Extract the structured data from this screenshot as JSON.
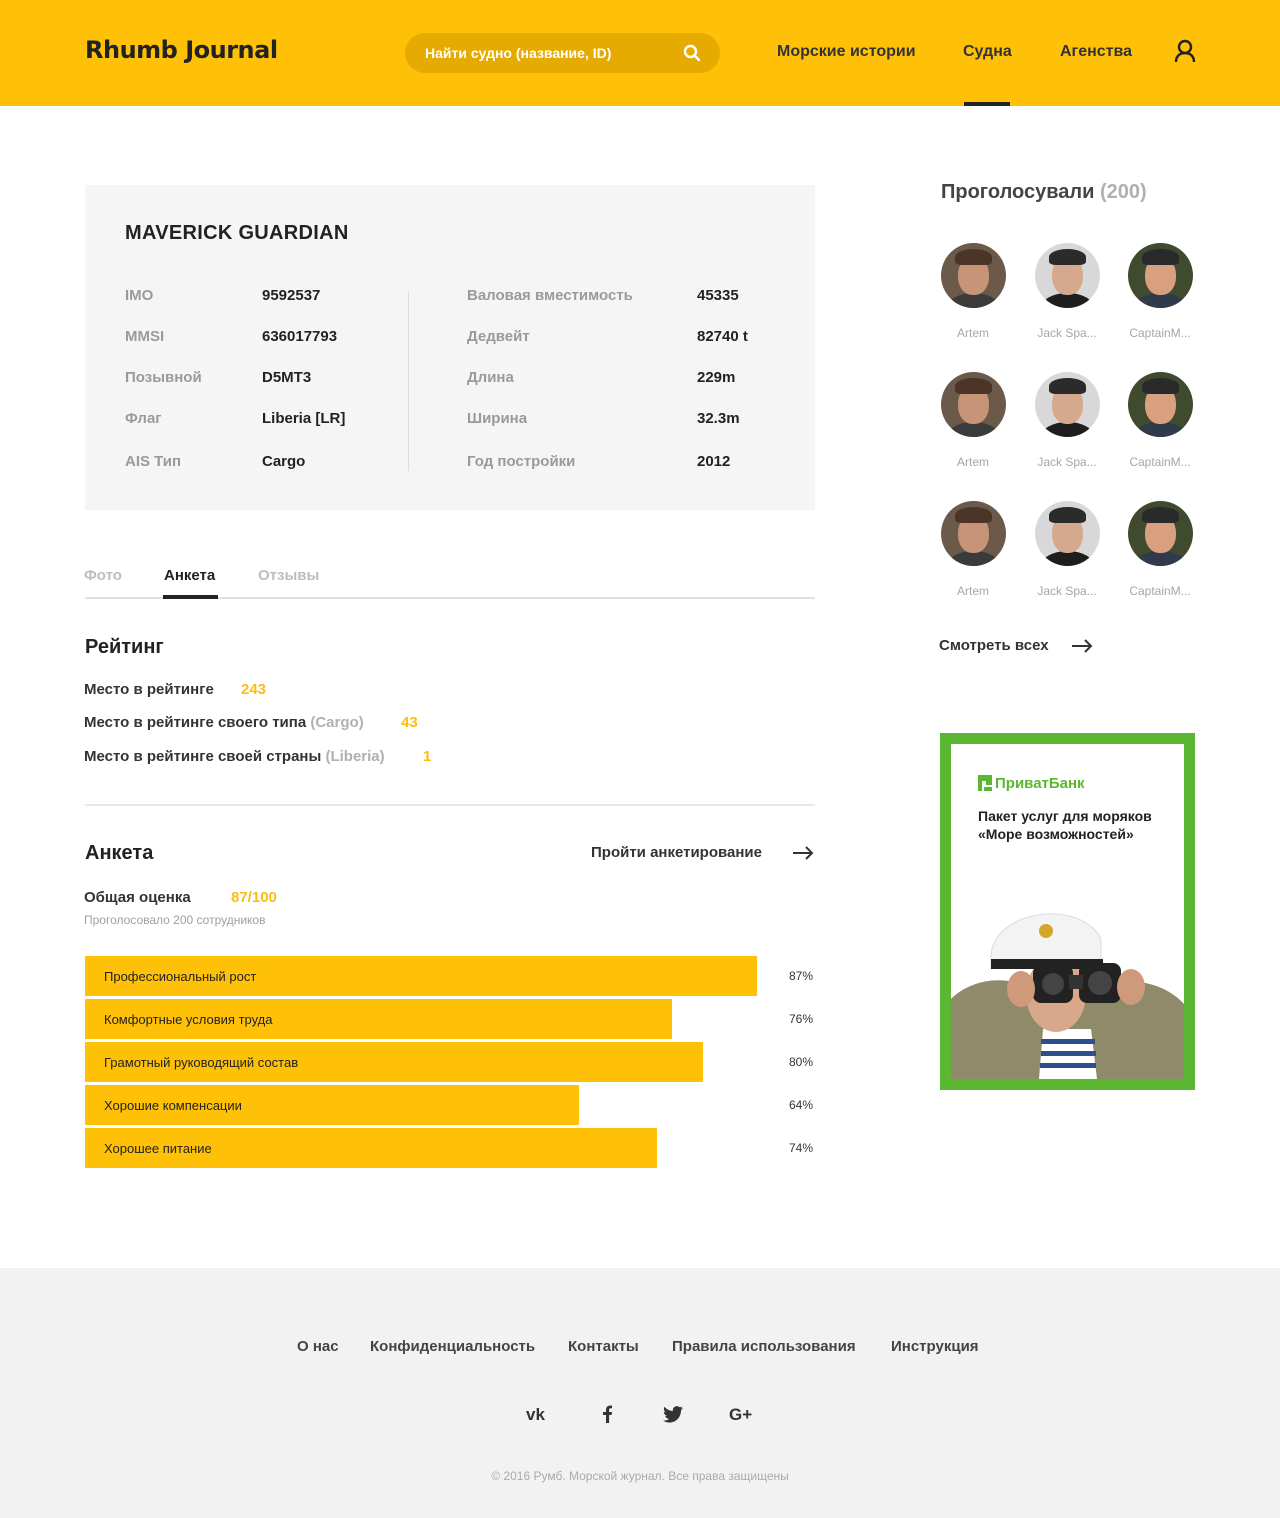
{
  "header": {
    "logo": "Rhumb Journal",
    "search_placeholder": "Найти судно (название, ID)",
    "nav": [
      "Морские истории",
      "Судна",
      "Агенства"
    ],
    "active_nav": "Судна"
  },
  "ship": {
    "name": "MAVERICK GUARDIAN",
    "left": [
      {
        "label": "IMO",
        "value": "9592537"
      },
      {
        "label": "MMSI",
        "value": "636017793"
      },
      {
        "label": "Позывной",
        "value": "D5MT3"
      },
      {
        "label": "Флаг",
        "value": "Liberia [LR]"
      },
      {
        "label": "AIS Тип",
        "value": "Cargo"
      }
    ],
    "right": [
      {
        "label": "Валовая вместимость",
        "value": "45335"
      },
      {
        "label": "Дедвейт",
        "value": "82740 t"
      },
      {
        "label": "Длина",
        "value": "229m"
      },
      {
        "label": "Ширина",
        "value": "32.3m"
      },
      {
        "label": "Год постройки",
        "value": "2012"
      }
    ]
  },
  "tabs": [
    "Фото",
    "Анкета",
    "Отзывы"
  ],
  "active_tab": "Анкета",
  "rating": {
    "title": "Рейтинг",
    "rows": [
      {
        "label": "Место в рейтинге",
        "qualifier": "",
        "value": "243"
      },
      {
        "label": "Место в рейтинге своего типа",
        "qualifier": "(Cargo)",
        "value": "43"
      },
      {
        "label": "Место в рейтинге своей страны",
        "qualifier": "(Liberia)",
        "value": "1"
      }
    ]
  },
  "survey": {
    "title": "Анкета",
    "action": "Пройти анкетирование",
    "overall_label": "Общая оценка",
    "overall_value": "87/100",
    "subtitle": "Проголосовало 200 сотрудников",
    "items": [
      {
        "label": "Профессиональный рост",
        "percent": 87,
        "percent_text": "87%"
      },
      {
        "label": "Комфортные условия труда",
        "percent": 76,
        "percent_text": "76%"
      },
      {
        "label": "Грамотный руководящий состав",
        "percent": 80,
        "percent_text": "80%"
      },
      {
        "label": "Хорошие компенсации",
        "percent": 64,
        "percent_text": "64%"
      },
      {
        "label": "Хорошее питание",
        "percent": 74,
        "percent_text": "74%"
      }
    ]
  },
  "voters": {
    "title": "Проголосували",
    "count": "(200)",
    "people": [
      "Artem",
      "Jack Spa...",
      "CaptainM...",
      "Artem",
      "Jack Spa...",
      "CaptainM...",
      "Artem",
      "Jack Spa...",
      "CaptainM..."
    ],
    "see_all": "Смотреть всех"
  },
  "banner": {
    "bank": "ПриватБанк",
    "text": "Пакет услуг для моряков «Море возможностей»"
  },
  "footer": {
    "links": [
      "О нас",
      "Конфиденциальность",
      "Контакты",
      "Правила использования",
      "Инструкция"
    ],
    "social": [
      "vk-icon",
      "facebook-icon",
      "twitter-icon",
      "google-plus-icon"
    ],
    "copyright": "© 2016 Румб. Морской журнал. Все права защищены"
  },
  "colors": {
    "accent": "#fec107",
    "accent_text": "#fcbd11",
    "banner_green": "#5bb731"
  }
}
